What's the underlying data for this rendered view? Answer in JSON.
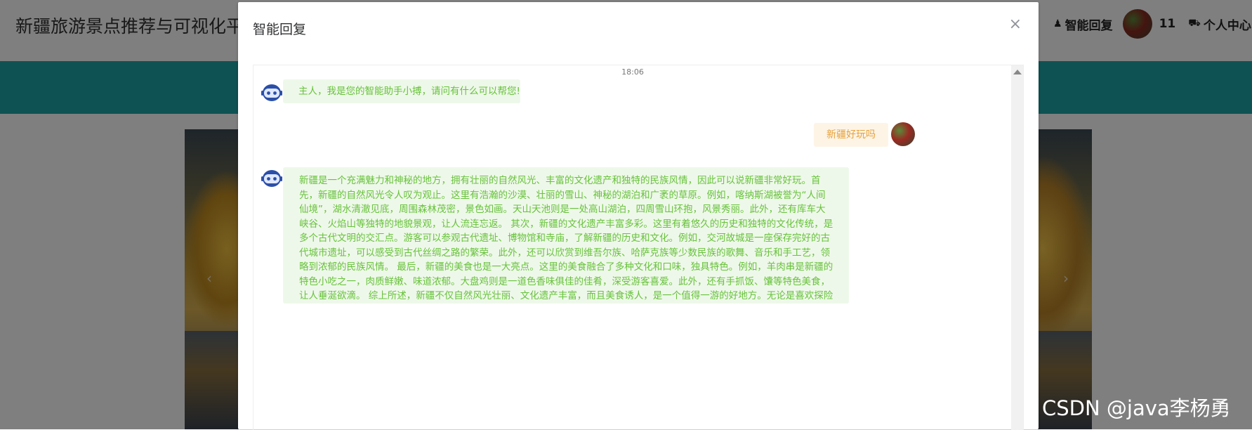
{
  "header": {
    "site_title": "新疆旅游景点推荐与可视化平台",
    "nav_smart_reply": "智能回复",
    "user_name": "11",
    "nav_personal_center": "个人中心"
  },
  "carousel": {
    "prev_icon": "‹",
    "next_icon": "›"
  },
  "dialog": {
    "title": "智能回复",
    "close_icon": "×",
    "chat": {
      "timestamp": "18:06",
      "messages": [
        {
          "role": "bot",
          "text": "主人，我是您的智能助手小搏，请问有什么可以帮您!"
        },
        {
          "role": "user",
          "text": "新疆好玩吗"
        },
        {
          "role": "bot",
          "text": "新疆是一个充满魅力和神秘的地方，拥有壮丽的自然风光、丰富的文化遗产和独特的民族风情，因此可以说新疆非常好玩。首先，新疆的自然风光令人叹为观止。这里有浩瀚的沙漠、壮丽的雪山、神秘的湖泊和广袤的草原。例如，喀纳斯湖被誉为“人间仙境”，湖水清澈见底，周围森林茂密，景色如画。天山天池则是一处高山湖泊，四周雪山环抱，风景秀丽。此外，还有库车大峡谷、火焰山等独特的地貌景观，让人流连忘返。 其次，新疆的文化遗产丰富多彩。这里有着悠久的历史和独特的文化传统，是多个古代文明的交汇点。游客可以参观古代遗址、博物馆和寺庙，了解新疆的历史和文化。例如，交河故城是一座保存完好的古代城市遗址，可以感受到古代丝绸之路的繁荣。此外，还可以欣赏到维吾尔族、哈萨克族等少数民族的歌舞、音乐和手工艺，领略到浓郁的民族风情。 最后，新疆的美食也是一大亮点。这里的美食融合了多种文化和口味，独具特色。例如，羊肉串是新疆的特色小吃之一，肉质鲜嫩、味道浓郁。大盘鸡则是一道色香味俱佳的佳肴，深受游客喜爱。此外，还有手抓饭、馕等特色美食，让人垂涎欲滴。 综上所述，新疆不仅自然风光壮丽、文化遗产丰富，而且美食诱人，是一个值得一游的好地方。无论是喜欢探险的游客，还是喜欢文化交流的游客，都能在新疆找到自己的乐趣。"
        }
      ]
    }
  },
  "watermark": "CSDN @java李杨勇",
  "icons": {
    "smart_reply_icon": "user-icon",
    "personal_center_icon": "truck-icon",
    "bot_avatar": "robot-icon"
  }
}
